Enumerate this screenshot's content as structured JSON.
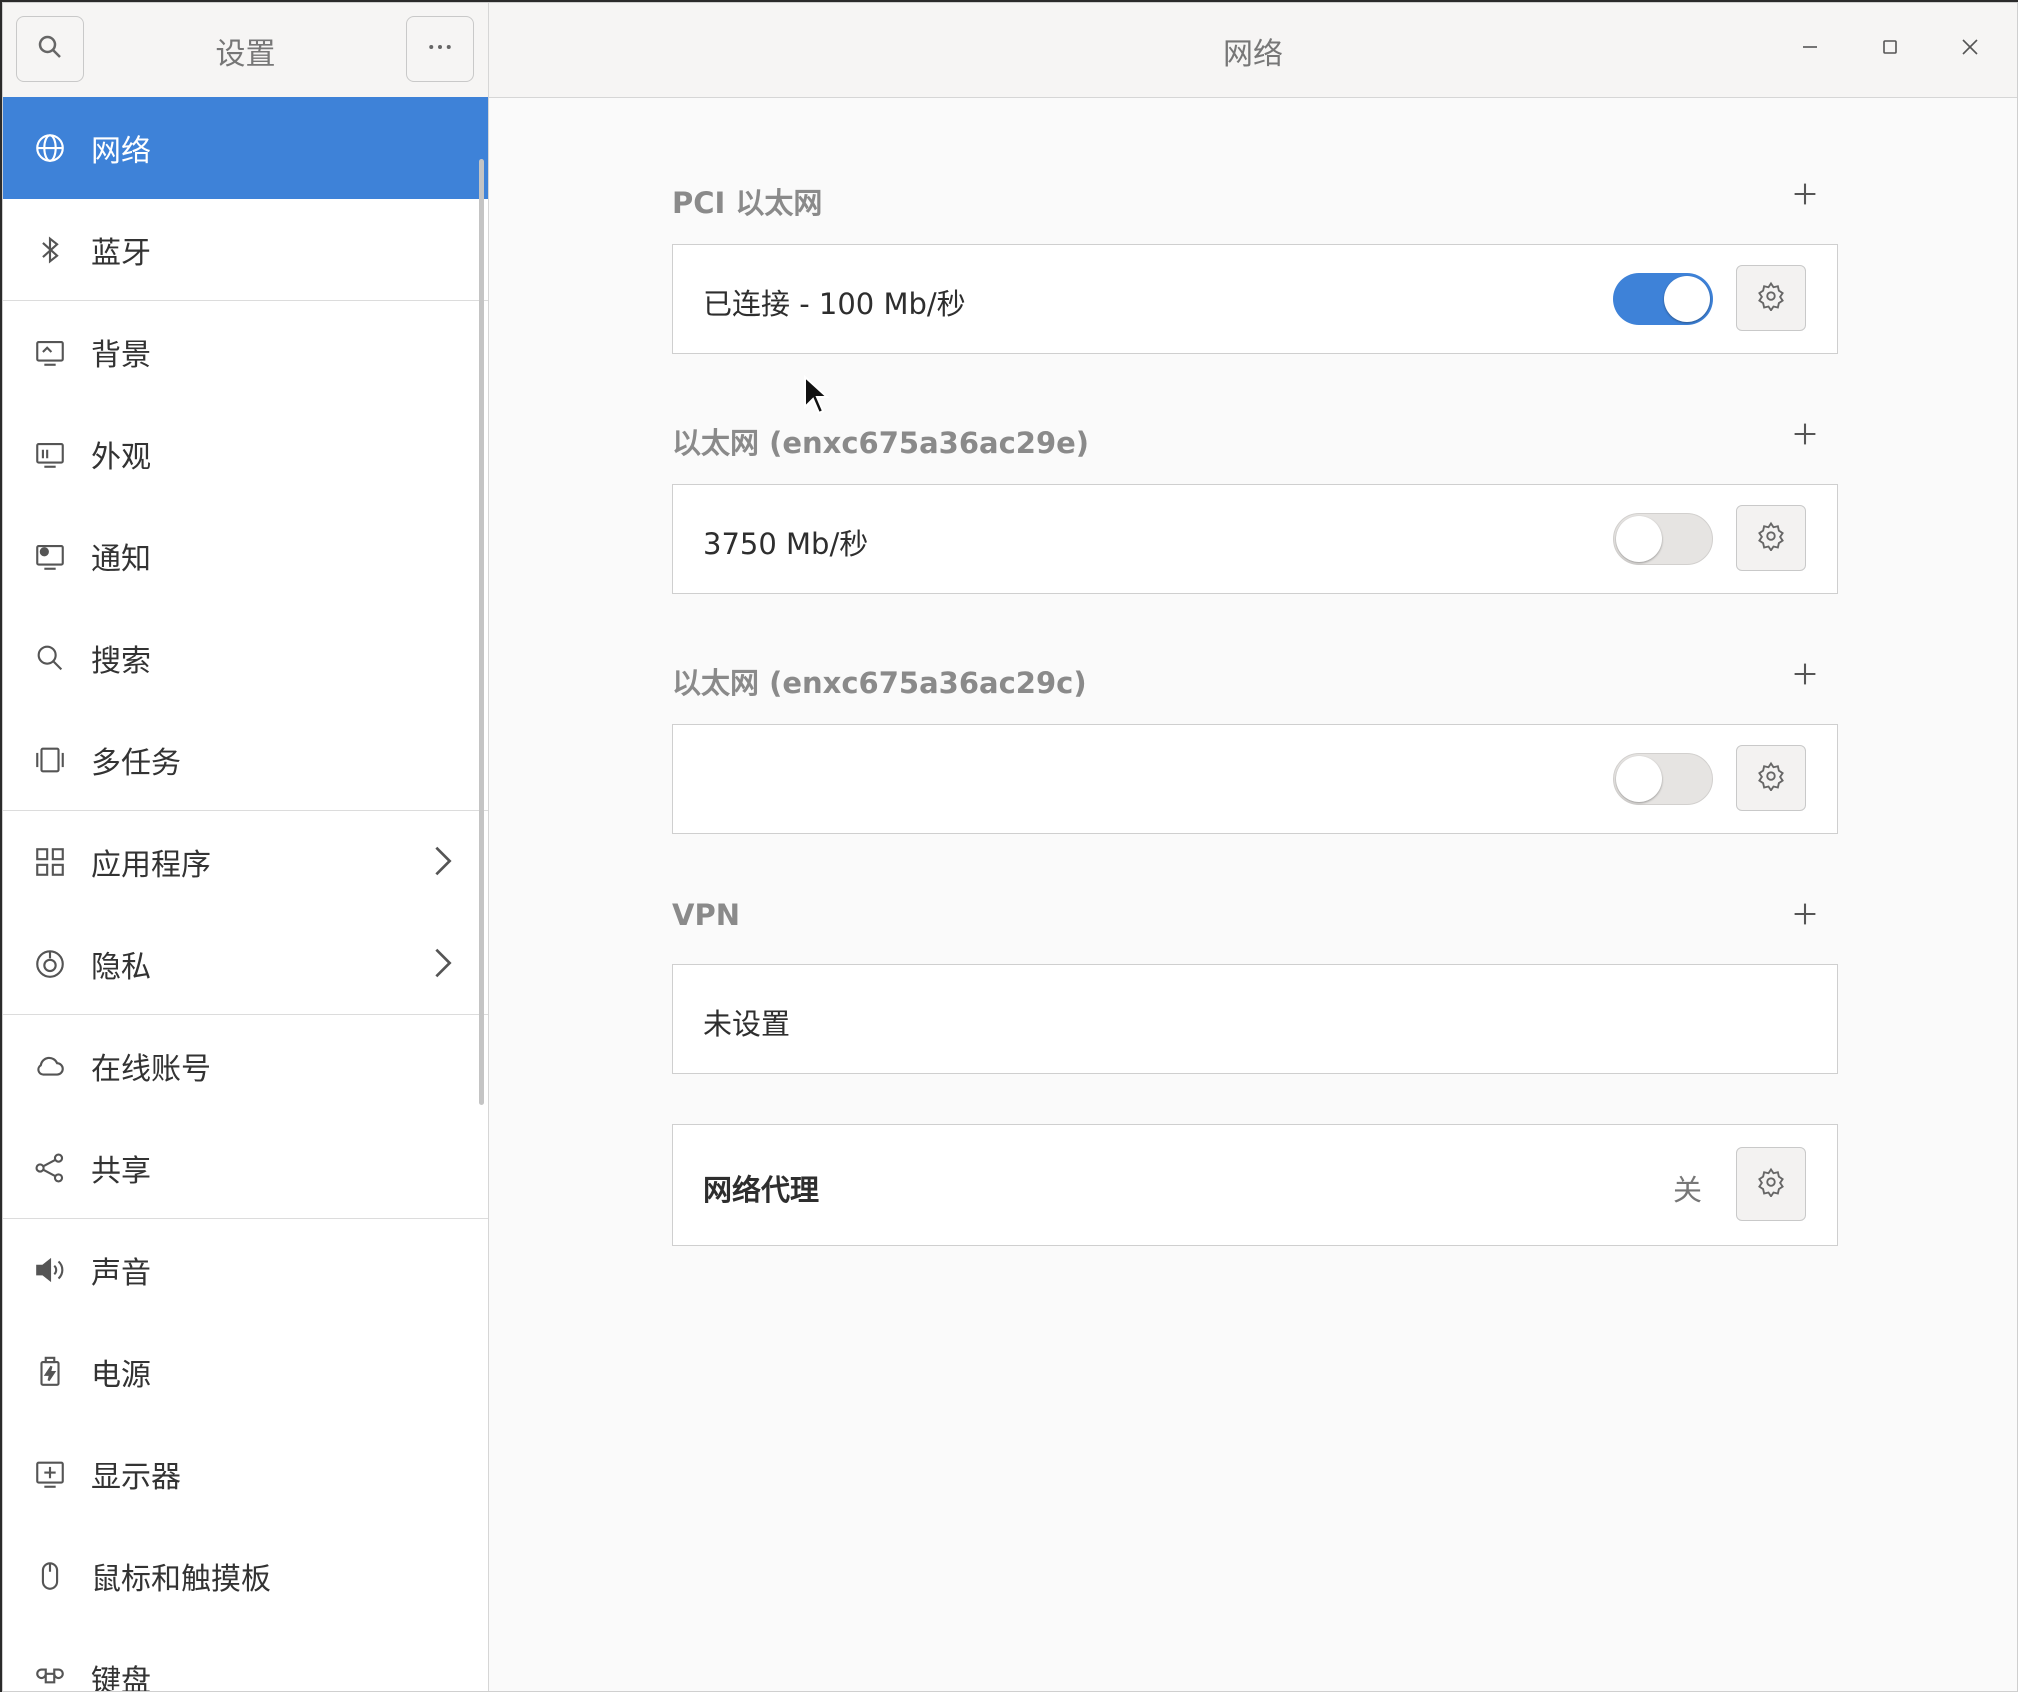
{
  "sidebar": {
    "title": "设置",
    "search_icon": "search-icon",
    "menu_icon": "more-horizontal-icon",
    "items": [
      {
        "label": "网络",
        "icon": "network-icon",
        "active": true
      },
      {
        "label": "蓝牙",
        "icon": "bluetooth-icon"
      },
      {
        "label": "背景",
        "icon": "background-icon"
      },
      {
        "label": "外观",
        "icon": "appearance-icon"
      },
      {
        "label": "通知",
        "icon": "notification-icon"
      },
      {
        "label": "搜索",
        "icon": "search-icon"
      },
      {
        "label": "多任务",
        "icon": "multitasking-icon"
      },
      {
        "label": "应用程序",
        "icon": "apps-icon",
        "chevron": true
      },
      {
        "label": "隐私",
        "icon": "privacy-icon",
        "chevron": true
      },
      {
        "label": "在线账号",
        "icon": "cloud-icon"
      },
      {
        "label": "共享",
        "icon": "share-icon"
      },
      {
        "label": "声音",
        "icon": "speaker-icon"
      },
      {
        "label": "电源",
        "icon": "power-icon"
      },
      {
        "label": "显示器",
        "icon": "display-icon"
      },
      {
        "label": "鼠标和触摸板",
        "icon": "mouse-icon"
      },
      {
        "label": "键盘",
        "icon": "keyboard-icon"
      }
    ]
  },
  "main": {
    "title": "网络",
    "sections": [
      {
        "title": "PCI 以太网",
        "card_label": "已连接 - 100 Mb/秒",
        "toggle": "on"
      },
      {
        "title": "以太网 (enxc675a36ac29e)",
        "card_label": "3750 Mb/秒",
        "toggle": "off"
      },
      {
        "title": "以太网 (enxc675a36ac29c)",
        "card_label": "",
        "toggle": "off"
      },
      {
        "title": "VPN",
        "card_label": "未设置"
      }
    ],
    "proxy": {
      "label": "网络代理",
      "state": "关"
    }
  },
  "colors": {
    "accent": "#3e82d8",
    "background": "#fafafa"
  }
}
